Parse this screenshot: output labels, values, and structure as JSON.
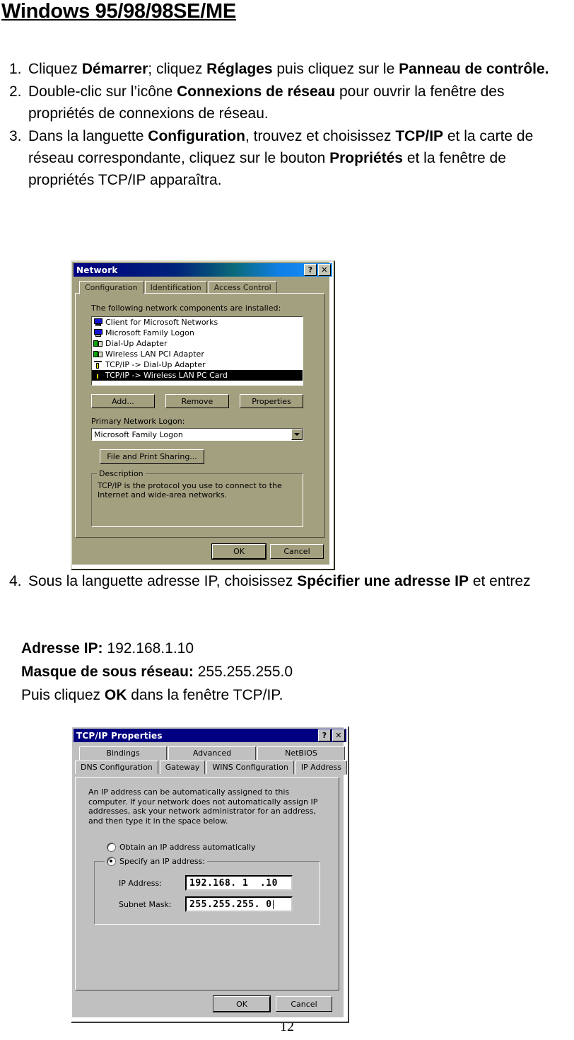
{
  "document": {
    "title": "Windows 95/98/98SE/ME",
    "page_number": "12",
    "steps": [
      {
        "num": "1.",
        "html": "Cliquez <b>Démarrer</b>; cliquez <b>Réglages</b> puis cliquez sur le <b>Panneau de contrôle.</b>"
      },
      {
        "num": "2.",
        "html": "Double-clic sur l’icône <b>Connexions de réseau</b> pour ouvrir la fenêtre des propriétés de connexions de réseau."
      },
      {
        "num": "3.",
        "html": "Dans la languette <b>Configuration</b>, trouvez et choisissez <b>TCP/IP</b> et la carte de réseau correspondante, cliquez sur le bouton <b>Propriétés</b> et la fenêtre de propriétés TCP/IP apparaîtra."
      },
      {
        "num": "4.",
        "html": "Sous la languette adresse IP, choisissez <b>Spécifier une adresse IP</b> et entrez"
      }
    ],
    "ip_lines": [
      {
        "html": "<b>Adresse IP:</b> 192.168.1.10"
      },
      {
        "html": "<b>Masque de sous réseau:</b> 255.255.255.0"
      },
      {
        "html": "Puis cliquez <b>OK</b> dans la fenêtre TCP/IP."
      }
    ]
  },
  "network_dialog": {
    "title": "Network",
    "help_button": "?",
    "close_button": "✕",
    "tabs": [
      {
        "label": "Configuration",
        "active": true
      },
      {
        "label": "Identification",
        "active": false
      },
      {
        "label": "Access Control",
        "active": false
      }
    ],
    "list_label": "The following network components are installed:",
    "components": [
      {
        "label": "Client for Microsoft Networks",
        "icon": "monitor-icon",
        "selected": false
      },
      {
        "label": "Microsoft Family Logon",
        "icon": "monitor-icon",
        "selected": false
      },
      {
        "label": "Dial-Up Adapter",
        "icon": "network-card-icon",
        "selected": false
      },
      {
        "label": "Wireless LAN PCI Adapter",
        "icon": "network-card-icon",
        "selected": false
      },
      {
        "label": "TCP/IP -> Dial-Up Adapter",
        "icon": "protocol-icon",
        "selected": false
      },
      {
        "label": "TCP/IP -> Wireless LAN  PC Card",
        "icon": "protocol-icon",
        "selected": true
      }
    ],
    "buttons": {
      "add": "Add...",
      "remove": "Remove",
      "properties": "Properties",
      "file_print_sharing": "File and Print Sharing...",
      "ok": "OK",
      "cancel": "Cancel"
    },
    "primary_logon_label": "Primary Network Logon:",
    "primary_logon_value": "Microsoft Family Logon",
    "description_group_label": "Description",
    "description_text": "TCP/IP is the protocol you use to connect to the Internet and wide-area networks."
  },
  "tcpip_dialog": {
    "title": "TCP/IP Properties",
    "help_button": "?",
    "close_button": "✕",
    "tabs_row1": [
      {
        "label": "Bindings",
        "active": false
      },
      {
        "label": "Advanced",
        "active": false
      },
      {
        "label": "NetBIOS",
        "active": false
      }
    ],
    "tabs_row2": [
      {
        "label": "DNS Configuration",
        "active": false
      },
      {
        "label": "Gateway",
        "active": false
      },
      {
        "label": "WINS Configuration",
        "active": false
      },
      {
        "label": "IP Address",
        "active": true
      }
    ],
    "description_text": "An IP address can be automatically assigned to this computer. If your network does not automatically assign IP addresses, ask your network administrator for an address, and then type it in the space below.",
    "radio_obtain": "Obtain an IP address automatically",
    "radio_specify": "Specify an IP address:",
    "radio_selected": "specify",
    "ip_address_label": "IP Address:",
    "ip_address_value": "192.168. 1  .10",
    "subnet_mask_label": "Subnet Mask:",
    "subnet_mask_value": "255.255.255. 0",
    "buttons": {
      "ok": "OK",
      "cancel": "Cancel"
    }
  }
}
